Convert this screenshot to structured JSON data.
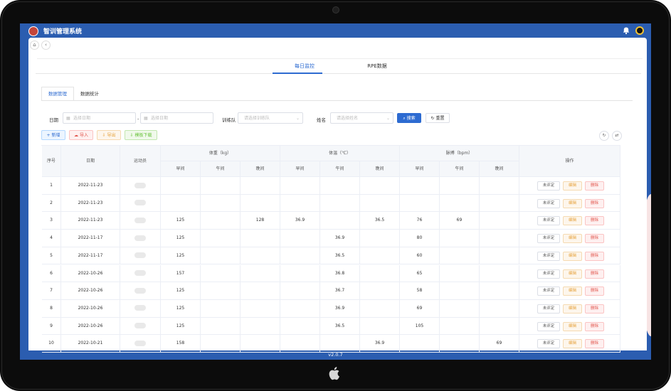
{
  "app": {
    "title": "智训管理系统",
    "version": "v2.0.7"
  },
  "tabs": [
    {
      "label": "每日监控",
      "active": true
    },
    {
      "label": "RPE数据",
      "active": false
    }
  ],
  "subtabs": [
    {
      "label": "数据管理",
      "active": true
    },
    {
      "label": "数据统计",
      "active": false
    }
  ],
  "filters": {
    "date_label": "日期",
    "start_placeholder": "选择日期",
    "end_placeholder": "选择日期",
    "team_label": "训练队",
    "team_placeholder": "请选择训练队",
    "name_label": "姓名",
    "name_placeholder": "请选择姓名",
    "search_label": "搜索",
    "reset_label": "重置"
  },
  "toolbar": {
    "add": "新增",
    "import": "导入",
    "export": "导出",
    "template": "模板下载"
  },
  "table": {
    "headers": {
      "index": "序号",
      "date": "日期",
      "athlete": "运动员",
      "weight": "体重（kg）",
      "temp": "体温（℃）",
      "pulse": "脉搏（bpm）",
      "actions": "操作",
      "morning": "早间",
      "noon": "午间",
      "evening": "晚间"
    },
    "actions": {
      "eval": "未评定",
      "edit": "编辑",
      "del": "删除"
    },
    "rows": [
      {
        "idx": "1",
        "date": "2022-11-23",
        "w": [
          "",
          "",
          ""
        ],
        "t": [
          "",
          "",
          ""
        ],
        "p": [
          "",
          "",
          ""
        ]
      },
      {
        "idx": "2",
        "date": "2022-11-23",
        "w": [
          "",
          "",
          ""
        ],
        "t": [
          "",
          "",
          ""
        ],
        "p": [
          "",
          "",
          ""
        ]
      },
      {
        "idx": "3",
        "date": "2022-11-23",
        "w": [
          "125",
          "",
          "128"
        ],
        "t": [
          "36.9",
          "",
          "36.5"
        ],
        "p": [
          "76",
          "69",
          ""
        ]
      },
      {
        "idx": "4",
        "date": "2022-11-17",
        "w": [
          "125",
          "",
          ""
        ],
        "t": [
          "",
          "36.9",
          ""
        ],
        "p": [
          "80",
          "",
          ""
        ]
      },
      {
        "idx": "5",
        "date": "2022-11-17",
        "w": [
          "125",
          "",
          ""
        ],
        "t": [
          "",
          "36.5",
          ""
        ],
        "p": [
          "60",
          "",
          ""
        ]
      },
      {
        "idx": "6",
        "date": "2022-10-26",
        "w": [
          "157",
          "",
          ""
        ],
        "t": [
          "",
          "36.8",
          ""
        ],
        "p": [
          "65",
          "",
          ""
        ]
      },
      {
        "idx": "7",
        "date": "2022-10-26",
        "w": [
          "125",
          "",
          ""
        ],
        "t": [
          "",
          "36.7",
          ""
        ],
        "p": [
          "58",
          "",
          ""
        ]
      },
      {
        "idx": "8",
        "date": "2022-10-26",
        "w": [
          "125",
          "",
          ""
        ],
        "t": [
          "",
          "36.9",
          ""
        ],
        "p": [
          "69",
          "",
          ""
        ]
      },
      {
        "idx": "9",
        "date": "2022-10-26",
        "w": [
          "125",
          "",
          ""
        ],
        "t": [
          "",
          "36.5",
          ""
        ],
        "p": [
          "105",
          "",
          ""
        ]
      },
      {
        "idx": "10",
        "date": "2022-10-21",
        "w": [
          "158",
          "",
          ""
        ],
        "t": [
          "",
          "",
          "36.9"
        ],
        "p": [
          "",
          "",
          "69"
        ]
      }
    ]
  }
}
